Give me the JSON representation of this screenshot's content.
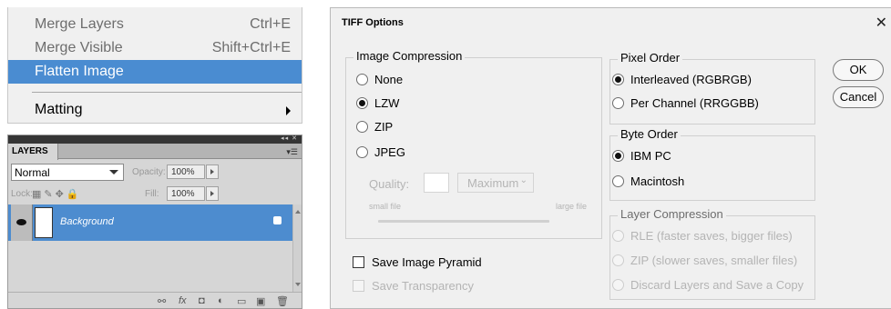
{
  "menu": {
    "items": [
      {
        "label": "Merge Layers",
        "shortcut": "Ctrl+E"
      },
      {
        "label": "Merge Visible",
        "shortcut": "Shift+Ctrl+E"
      },
      {
        "label": "Flatten Image",
        "shortcut": ""
      },
      {
        "label": "Matting",
        "shortcut": ""
      }
    ],
    "highlight_color": "#4a8cd1"
  },
  "layers_panel": {
    "tab_label": "LAYERS",
    "blend_mode": "Normal",
    "opacity_label": "Opacity:",
    "opacity_value": "100%",
    "lock_label": "Lock:",
    "fill_label": "Fill:",
    "fill_value": "100%",
    "layers": [
      {
        "name": "Background",
        "selected": true,
        "locked": true
      }
    ],
    "selected_color": "#4d8ccf"
  },
  "dialog": {
    "title": "TIFF Options",
    "image_compression": {
      "legend": "Image Compression",
      "options": [
        "None",
        "LZW",
        "ZIP",
        "JPEG"
      ],
      "selected": "LZW",
      "quality_label": "Quality:",
      "quality_preset": "Maximum",
      "small_file": "small file",
      "large_file": "large file"
    },
    "pixel_order": {
      "legend": "Pixel Order",
      "options": [
        "Interleaved (RGBRGB)",
        "Per Channel (RRGGBB)"
      ],
      "selected": "Interleaved (RGBRGB)"
    },
    "byte_order": {
      "legend": "Byte Order",
      "options": [
        "IBM PC",
        "Macintosh"
      ],
      "selected": "IBM PC"
    },
    "layer_compression": {
      "legend": "Layer Compression",
      "options": [
        "RLE (faster saves, bigger files)",
        "ZIP (slower saves, smaller files)",
        "Discard Layers and Save a Copy"
      ]
    },
    "save_image_pyramid": "Save Image Pyramid",
    "save_transparency": "Save Transparency",
    "ok_label": "OK",
    "cancel_label": "Cancel"
  }
}
